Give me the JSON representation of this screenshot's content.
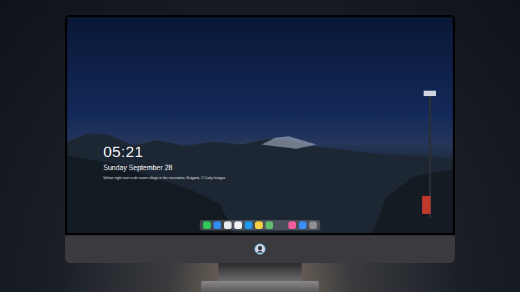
{
  "screen": {
    "lock_screen": {
      "time": "05:21",
      "date": "Sunday September 28",
      "caption": "Winter night over a ski resort village in the mountains, Bulgaria. © Getty Images"
    }
  },
  "dock": {
    "items": [
      {
        "kind": "app",
        "color": "#34c759"
      },
      {
        "kind": "app",
        "color": "#2f8cf0"
      },
      {
        "kind": "app",
        "color": "#e9ecef"
      },
      {
        "kind": "app",
        "color": "#f2f2f2"
      },
      {
        "kind": "app",
        "color": "#1e9bf0"
      },
      {
        "kind": "app",
        "color": "#f7d046"
      },
      {
        "kind": "app",
        "color": "#5fbf6a"
      },
      {
        "kind": "separator",
        "color": "#000000"
      },
      {
        "kind": "app",
        "color": "#f25f9c"
      },
      {
        "kind": "app",
        "color": "#3a8ef6"
      },
      {
        "kind": "app",
        "color": "#8e8e93"
      }
    ]
  }
}
